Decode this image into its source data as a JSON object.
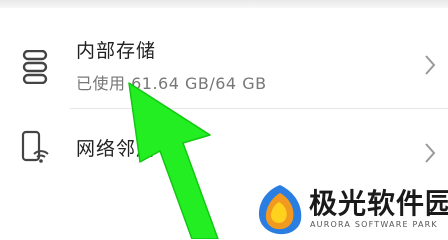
{
  "settings": {
    "storage": {
      "title": "内部存储",
      "subtitle": "已使用 61.64 GB/64 GB"
    },
    "network": {
      "title": "网络邻居"
    }
  },
  "watermark": {
    "name": "极光软件园",
    "tagline": "AURORA SOFTWARE PARK"
  },
  "colors": {
    "annotation_arrow": "#22ee22",
    "logo_blue": "#2a7de1",
    "logo_orange": "#f29a1f",
    "logo_yellow": "#ffd21e"
  },
  "icons": {
    "storage": "storage-stack-icon",
    "network": "phone-wifi-icon",
    "chevron": "chevron-right-icon"
  }
}
